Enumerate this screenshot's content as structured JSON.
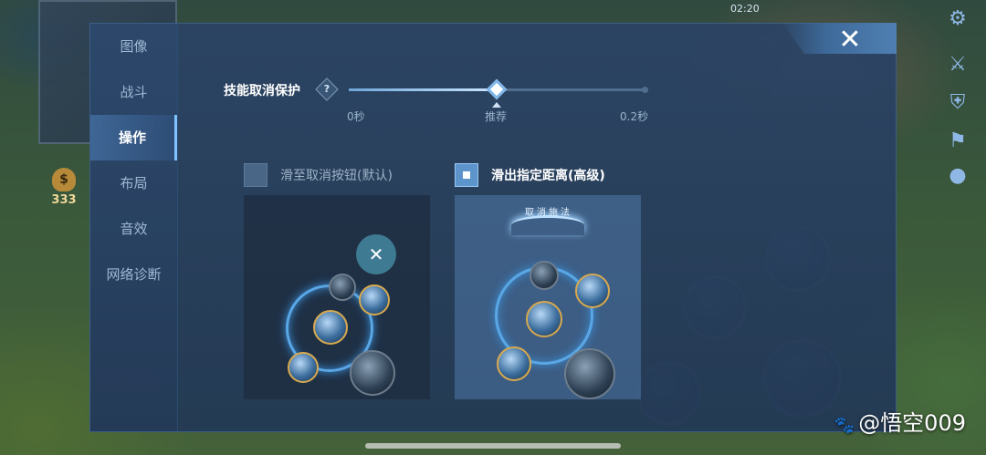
{
  "status": {
    "time": "02:20"
  },
  "hud": {
    "gold": "333"
  },
  "sidebar": {
    "items": [
      {
        "label": "图像",
        "active": false
      },
      {
        "label": "战斗",
        "active": false
      },
      {
        "label": "操作",
        "active": true
      },
      {
        "label": "布局",
        "active": false
      },
      {
        "label": "音效",
        "active": false
      },
      {
        "label": "网络诊断",
        "active": false
      }
    ]
  },
  "close": {
    "icon": "close-icon",
    "glyph": "✕"
  },
  "setting": {
    "label": "技能取消保护",
    "help_glyph": "?",
    "slider": {
      "min_label": "0秒",
      "recommend_label": "推荐",
      "max_label": "0.2秒",
      "value_fraction": 0.5
    }
  },
  "options": [
    {
      "label": "滑至取消按钮(默认)",
      "checked": false
    },
    {
      "label": "滑出指定距离(高级)",
      "checked": true
    }
  ],
  "preview": {
    "cancel_button_glyph": "✕",
    "cancel_arc_label": "取消施法"
  },
  "watermark": {
    "text": "@悟空009",
    "paw": "🐾"
  },
  "colors": {
    "accent": "#7fc2ff",
    "panel": "#263c5a",
    "checked": "#5d94cc"
  }
}
